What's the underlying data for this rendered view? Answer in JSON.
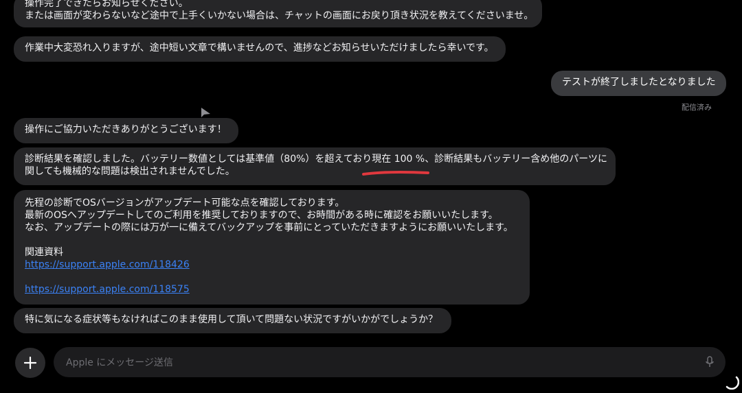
{
  "messages": {
    "m1": {
      "line1": "操作完了できたらお知らせください。",
      "line2": "または画面が変わらないなど途中で上手くいかない場合は、チャットの画面にお戻り頂き状況を教えてくださいませ。"
    },
    "m2": "作業中大変恐れ入りますが、途中短い文章で構いませんので、進捗などお知らせいただけましたら幸いです。",
    "m3": "テストが終了しましたとなりました",
    "m3_status": "配信済み",
    "m4": "操作にご協力いただきありがとうございます！",
    "m5": {
      "line1": "診断結果を確認しました。バッテリー数値としては基準値（80%）を超えており現在 100 %、診断結果もバッテリー含め他のパーツに",
      "line2": "関しても機械的な問題は検出されませんでした。"
    },
    "m6": {
      "line1": "先程の診断でOSバージョンがアップデート可能な点を確認しております。",
      "line2": "最新のOSへアップデートしてのご利用を推奨しておりますので、お時間がある時に確認をお願いいたします。",
      "line3": "なお、アップデートの際には万が一に備えてバックアップを事前にとっていただきますようにお願いいたします。",
      "related_heading": "関連資料",
      "link1": "https://support.apple.com/118426",
      "link2": "https://support.apple.com/118575"
    },
    "m7": "特に気になる症状等もなければこのまま使用して頂いて問題ない状況ですがいかがでしょうか？"
  },
  "composer": {
    "placeholder": "Apple にメッセージ送信",
    "plus_icon": "plus-icon",
    "mic_icon": "microphone-icon"
  },
  "colors": {
    "background": "#000000",
    "incoming_bubble": "#262628",
    "outgoing_bubble": "#3a3b3e",
    "link": "#3b82f6",
    "annotation": "#e0383e"
  }
}
